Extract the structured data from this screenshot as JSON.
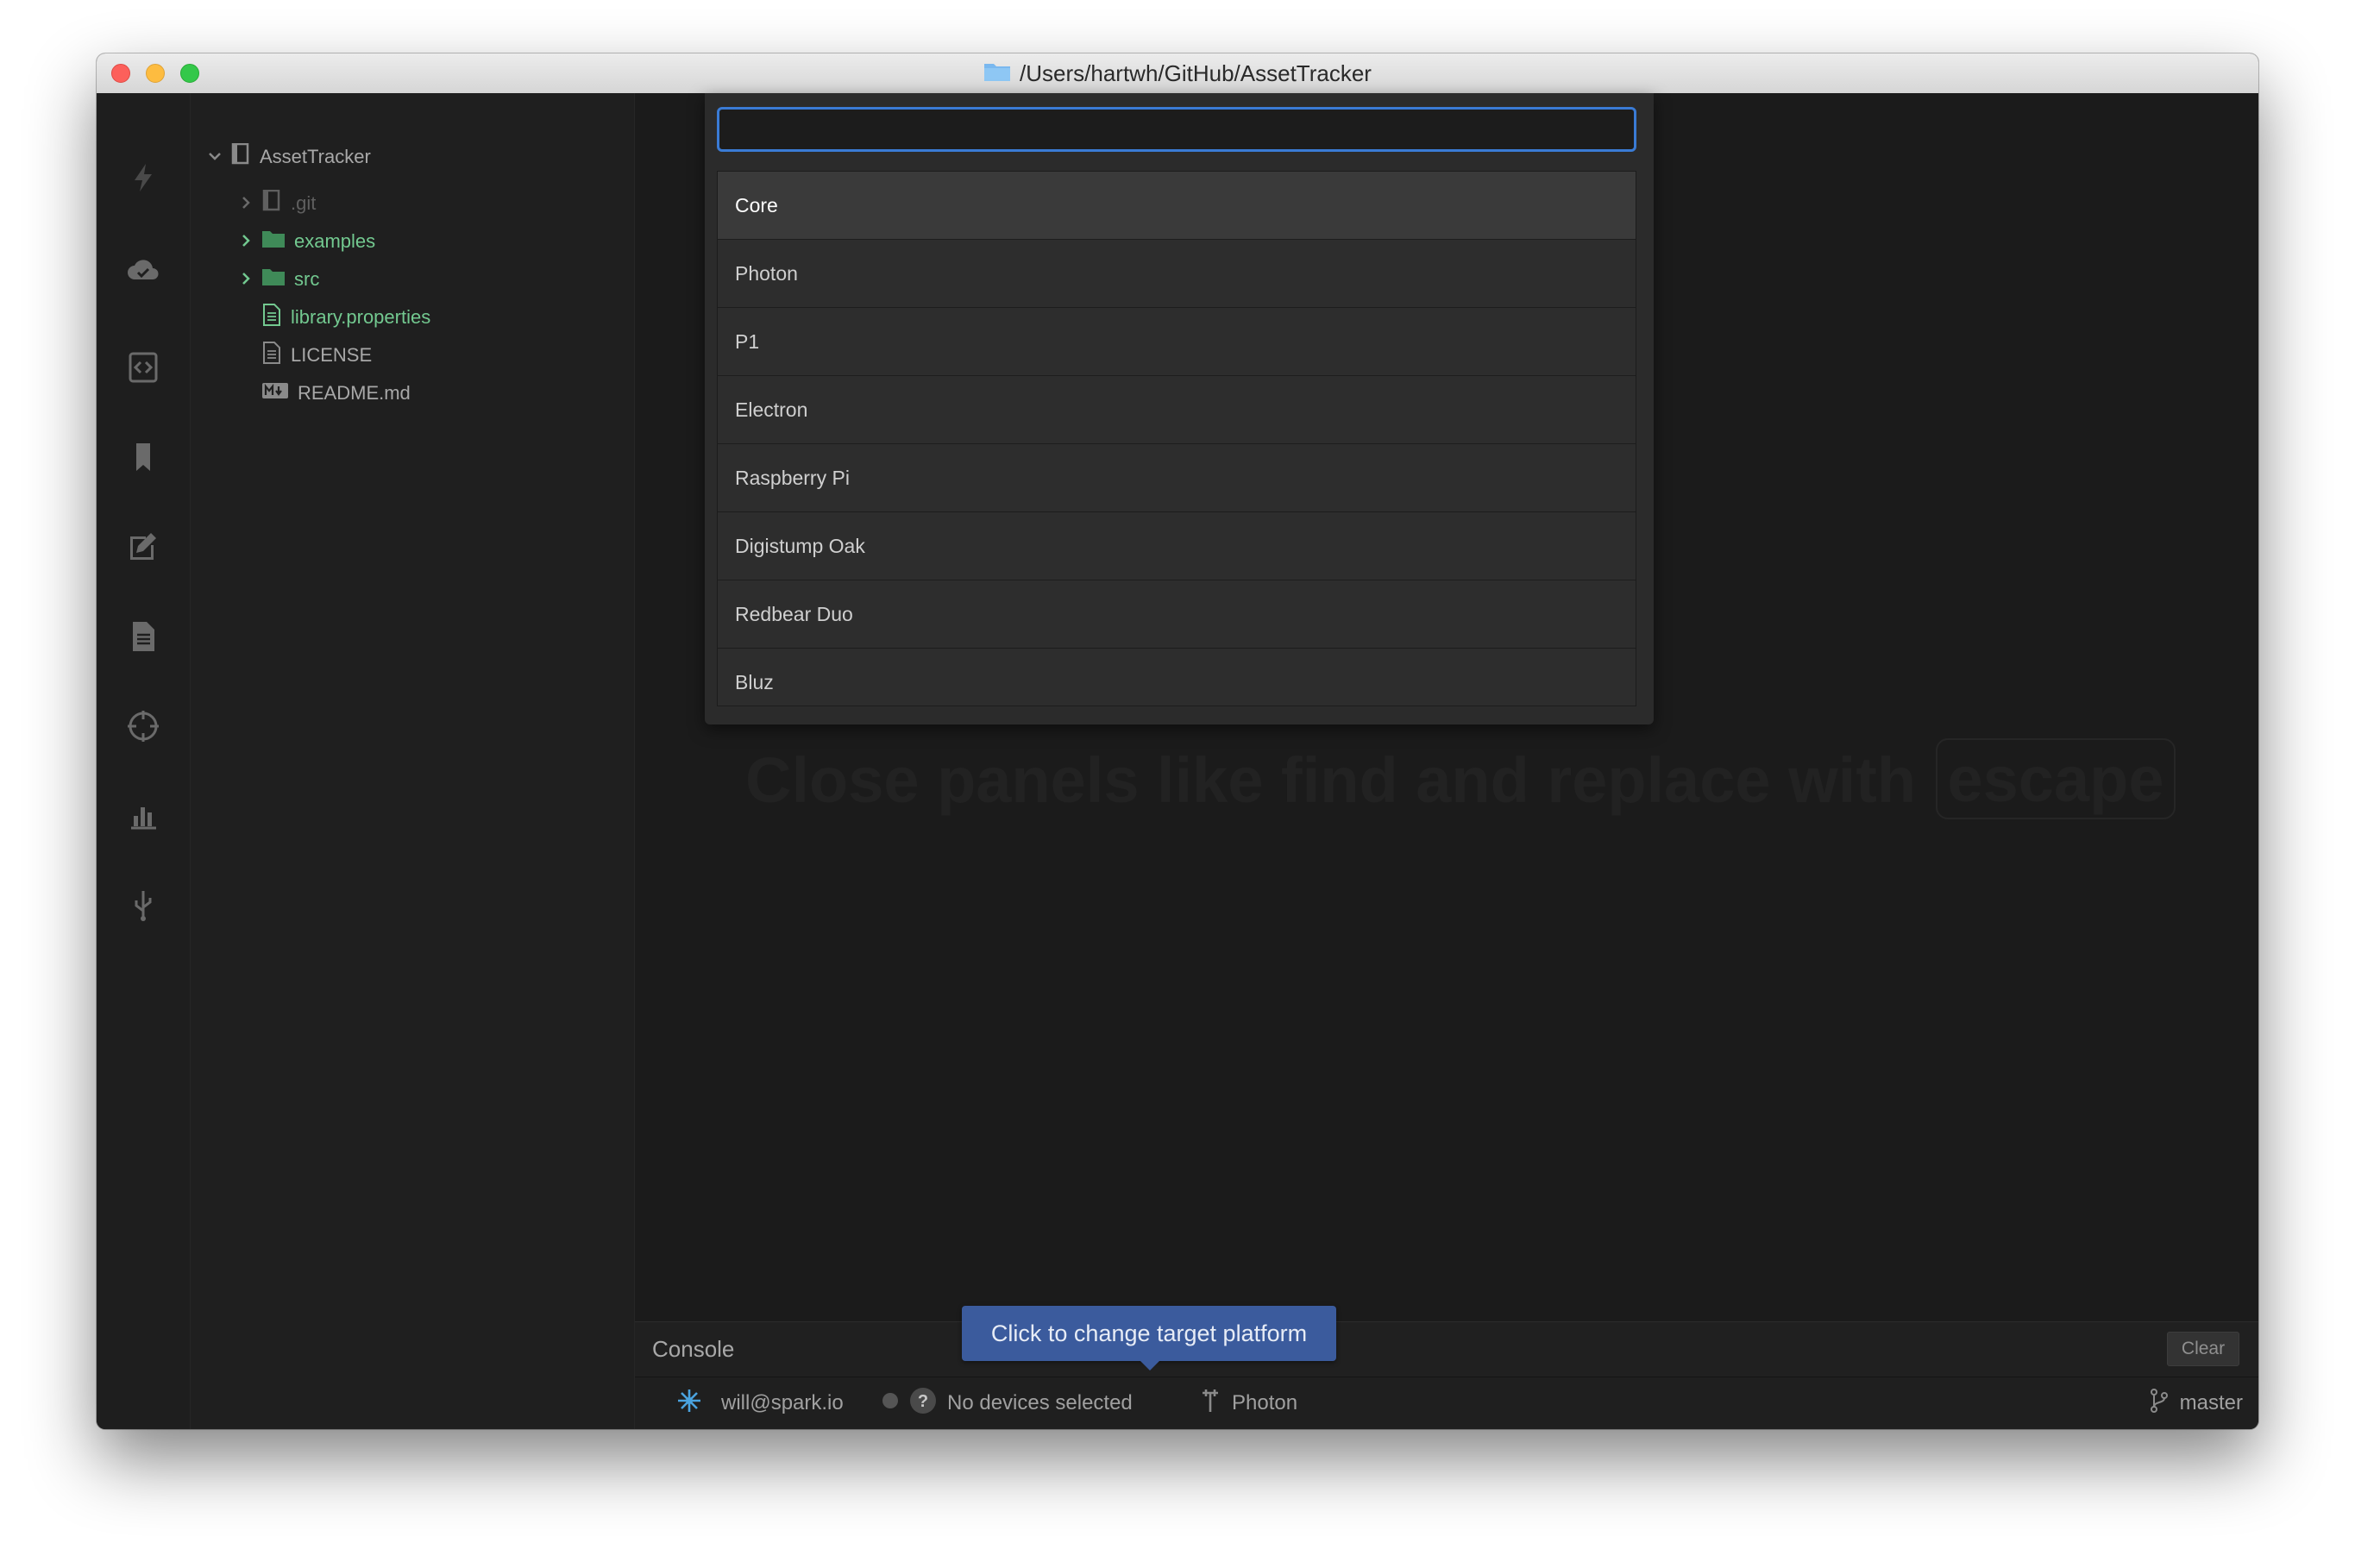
{
  "window": {
    "title": "/Users/hartwh/GitHub/AssetTracker"
  },
  "activity_bar": {
    "icons": [
      "bolt-icon",
      "cloud-icon",
      "code-file-icon",
      "bookmark-icon",
      "edit-icon",
      "document-icon",
      "target-icon",
      "chart-icon",
      "usb-icon"
    ]
  },
  "tree": {
    "project": "AssetTracker",
    "items": [
      {
        "label": ".git",
        "type": "repo"
      },
      {
        "label": "examples",
        "type": "folder"
      },
      {
        "label": "src",
        "type": "folder"
      },
      {
        "label": "library.properties",
        "type": "file"
      },
      {
        "label": "LICENSE",
        "type": "file"
      },
      {
        "label": "README.md",
        "type": "markdown"
      }
    ],
    "colors": {
      "modified": "#73c990",
      "default": "#a8a8a8",
      "ignored": "#5f5f5f"
    }
  },
  "background_hint": {
    "text": "Close panels like find and replace with",
    "key": "escape"
  },
  "palette": {
    "query": "",
    "options": [
      "Core",
      "Photon",
      "P1",
      "Electron",
      "Raspberry Pi",
      "Digistump Oak",
      "Redbear Duo",
      "Bluz"
    ],
    "selected": "Core"
  },
  "console": {
    "label": "Console",
    "clear_label": "Clear"
  },
  "tooltip": {
    "text": "Click to change target platform"
  },
  "status_bar": {
    "user": "will@spark.io",
    "device": "No devices selected",
    "platform": "Photon",
    "branch": "master"
  },
  "accent": "#3a7bd5"
}
